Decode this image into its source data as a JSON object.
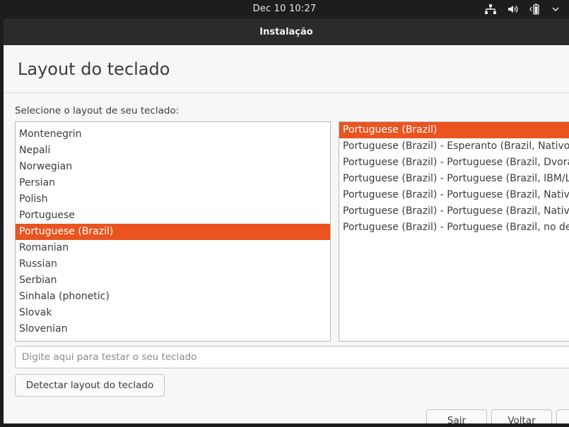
{
  "top_bar": {
    "clock": "Dec 10  10:27",
    "icons": [
      "network-icon",
      "volume-icon",
      "battery-icon",
      "menu-arrow-icon"
    ]
  },
  "window": {
    "title": "Instalação",
    "page_title": "Layout do teclado",
    "prompt": "Selecione o layout de seu teclado:"
  },
  "layouts": {
    "items": [
      "Montenegrin",
      "Nepali",
      "Norwegian",
      "Persian",
      "Polish",
      "Portuguese",
      "Portuguese (Brazil)",
      "Romanian",
      "Russian",
      "Serbian",
      "Sinhala (phonetic)",
      "Slovak",
      "Slovenian"
    ],
    "selected": "Portuguese (Brazil)"
  },
  "variants": {
    "items": [
      "Portuguese (Brazil)",
      "Portuguese (Brazil) - Esperanto (Brazil, Nativo)",
      "Portuguese (Brazil) - Portuguese (Brazil, Dvorak)",
      "Portuguese (Brazil) - Portuguese (Brazil, IBM/Lenovo ThinkPad)",
      "Portuguese (Brazil) - Portuguese (Brazil, Nativo for US keyboards)",
      "Portuguese (Brazil) - Portuguese (Brazil, Nativo)",
      "Portuguese (Brazil) - Portuguese (Brazil, no dead keys)"
    ],
    "selected": "Portuguese (Brazil)"
  },
  "test_field": {
    "placeholder": "Digite aqui para testar o seu teclado",
    "value": ""
  },
  "buttons": {
    "detect": "Detectar layout do teclado",
    "quit": "Sair",
    "back": "Voltar",
    "next": ""
  },
  "colors": {
    "accent": "#e95420",
    "titlebar": "#2b2b2b",
    "topbar": "#1d1d1d"
  }
}
